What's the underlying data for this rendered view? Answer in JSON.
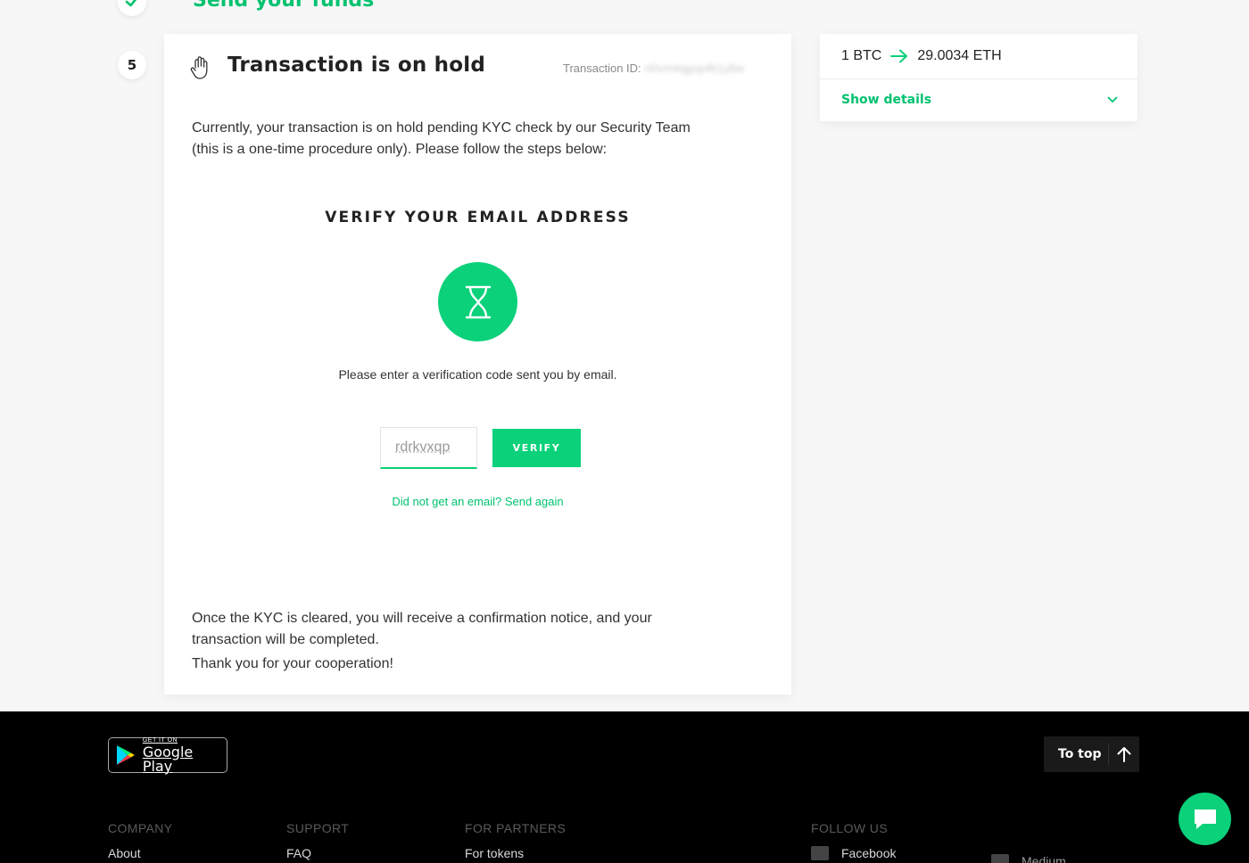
{
  "previous_step": {
    "title": "Send your funds"
  },
  "current_step": {
    "number": "5",
    "title": "Transaction is on hold",
    "transaction_id_label": "Transaction ID:",
    "transaction_id_value": "n0vm4qgsp4k1y6w",
    "intro": "Currently, your transaction is on hold pending KYC check by our Security Team (this is a one-time procedure only). Please follow the steps below:",
    "verify": {
      "heading": "VERIFY YOUR EMAIL ADDRESS",
      "instructions": "Please enter a verification code sent you by email.",
      "code_value": "rdrkvxqp",
      "button_label": "VERIFY",
      "resend_link": "Did not get an email? Send again"
    },
    "outro": "Once the KYC is cleared, you will receive a confirmation notice, and your transaction will be completed.",
    "thanks": "Thank you for your cooperation!"
  },
  "summary": {
    "from_amount": "1 BTC",
    "to_amount": "29.0034 ETH",
    "details_label": "Show details"
  },
  "footer": {
    "google_play_small": "GET IT ON",
    "google_play_big": "Google Play",
    "to_top_label": "To top",
    "columns": [
      {
        "heading": "COMPANY",
        "first_link": "About"
      },
      {
        "heading": "SUPPORT",
        "first_link": "FAQ"
      },
      {
        "heading": "FOR PARTNERS",
        "first_link": "For tokens"
      },
      {
        "heading": "FOLLOW US",
        "first_link": "Facebook",
        "second_link": "Medium"
      }
    ]
  },
  "colors": {
    "accent": "#0bd17a",
    "accent_text": "#00c26f",
    "footer_bg": "#000000"
  },
  "icons": {
    "step_done": "check-icon",
    "hold": "hand-icon",
    "status": "hourglass-icon",
    "rate_arrow": "arrow-right-icon",
    "details": "chevron-down-icon",
    "to_top": "arrow-up-icon",
    "chat": "chat-icon"
  }
}
